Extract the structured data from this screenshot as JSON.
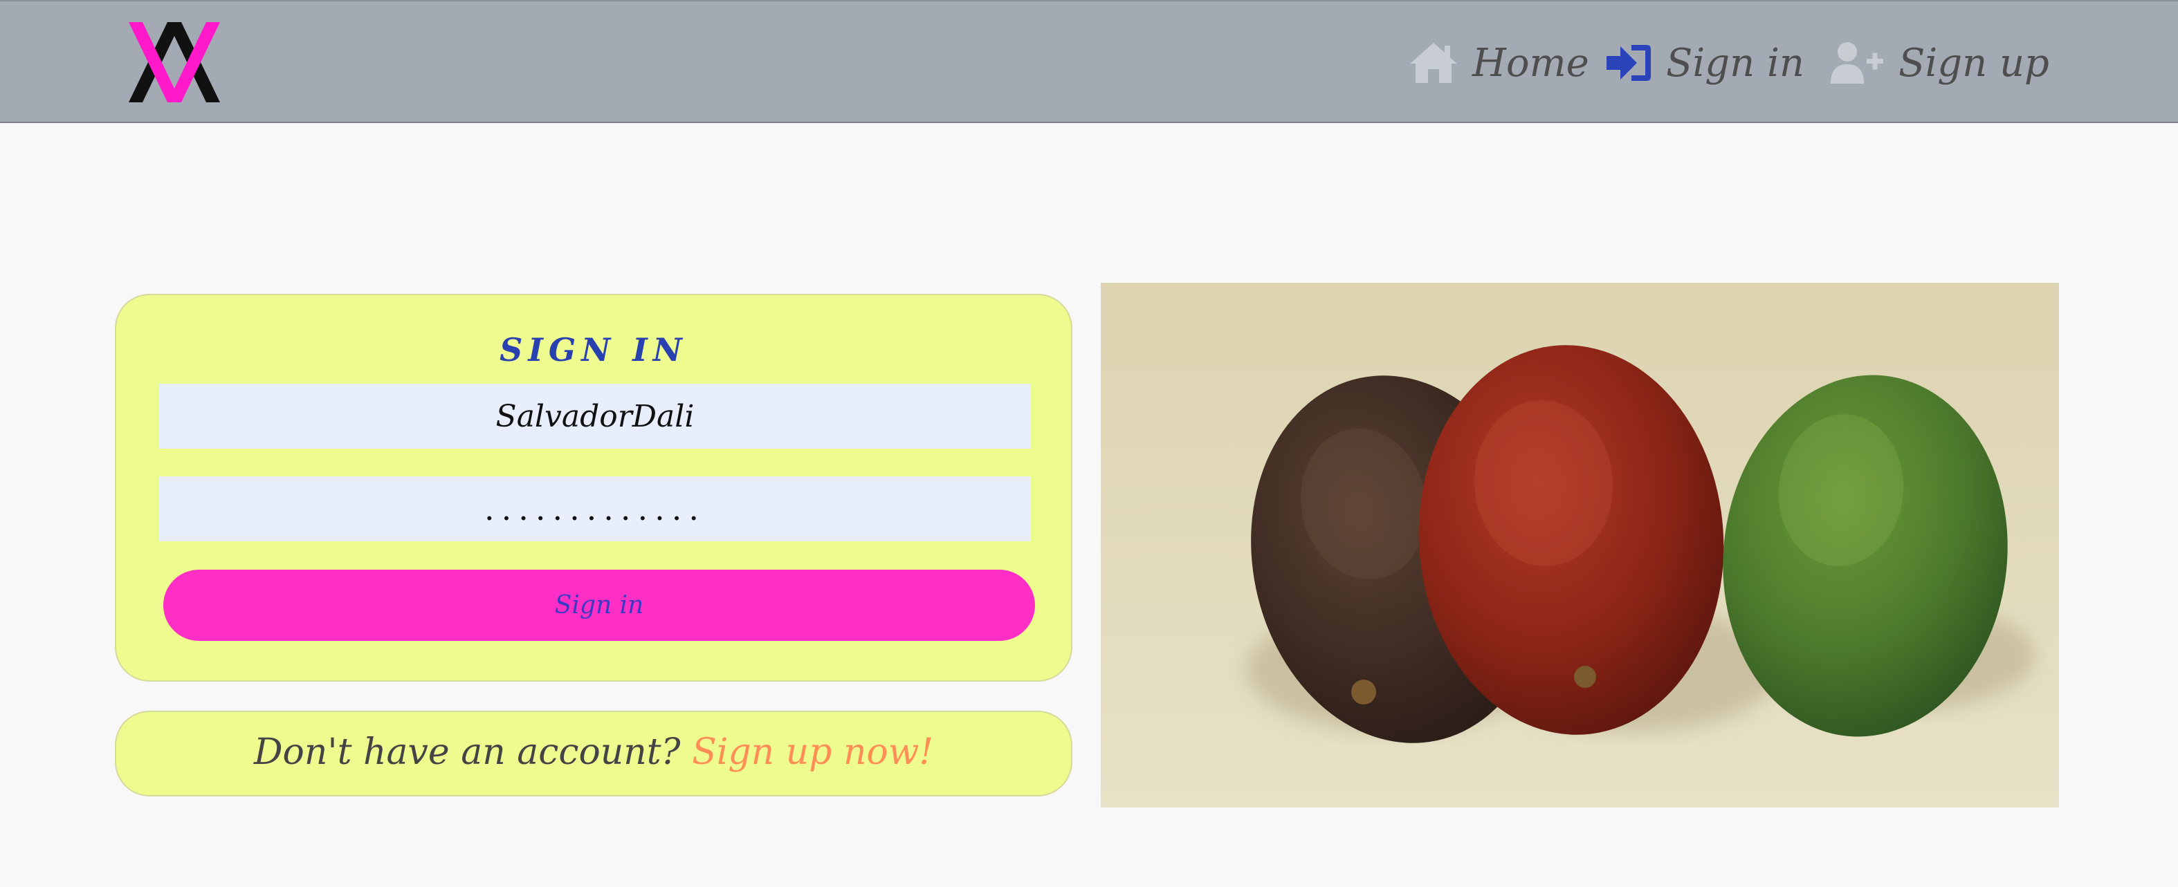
{
  "nav": {
    "home": "Home",
    "signin": "Sign in",
    "signup": "Sign up"
  },
  "signin_form": {
    "title": "SIGN IN",
    "username_value": "SalvadorDali",
    "password_value": ".............",
    "submit_label": "Sign in"
  },
  "signup_prompt": {
    "question": "Don't have an account?",
    "link": "Sign up now!"
  },
  "colors": {
    "navbar": "#a3aab4",
    "card": "#eefb8f",
    "input": "#e8eefc",
    "button": "#ff2ec4",
    "title": "#2940b0",
    "link": "#ff8e56",
    "logo_accent": "#ff19c8"
  },
  "icons": {
    "home": "home-icon",
    "signin": "sign-in-icon",
    "signup": "user-plus-icon",
    "logo": "logo-icon"
  }
}
